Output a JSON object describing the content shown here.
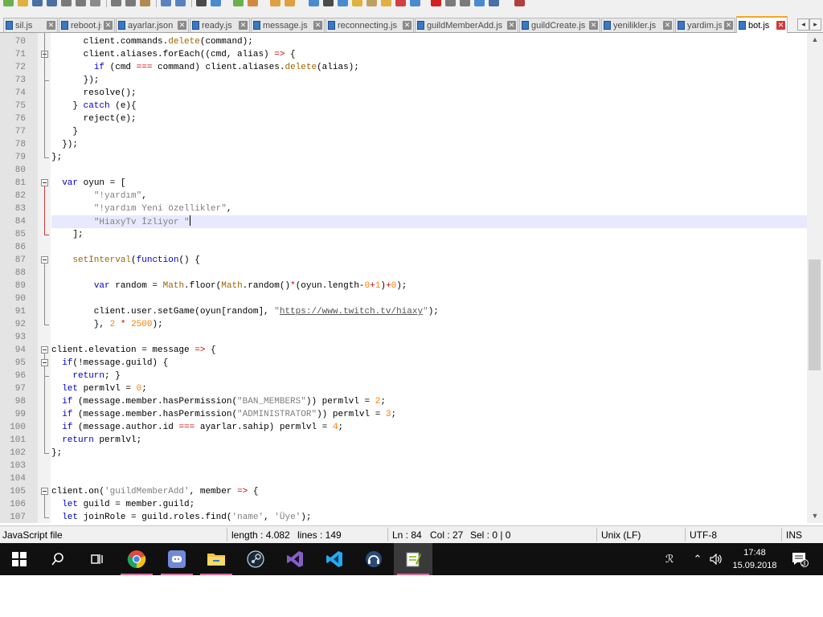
{
  "tabs": [
    {
      "name": "sil.js",
      "active": false
    },
    {
      "name": "reboot.js",
      "active": false
    },
    {
      "name": "ayarlar.json",
      "active": false
    },
    {
      "name": "ready.js",
      "active": false
    },
    {
      "name": "message.js",
      "active": false
    },
    {
      "name": "reconnecting.js",
      "active": false
    },
    {
      "name": "guildMemberAdd.js",
      "active": false
    },
    {
      "name": "guildCreate.js",
      "active": false
    },
    {
      "name": "yenilikler.js",
      "active": false
    },
    {
      "name": "yardim.js",
      "active": false
    },
    {
      "name": "bot.js",
      "active": true
    }
  ],
  "tab_scroll": {
    "left": "◂",
    "right": "▸"
  },
  "colors": {
    "keyword": "#0000c8",
    "string": "#808080",
    "number": "#ff8000",
    "func": "#a06400",
    "operator": "#d00000",
    "url": "#555555",
    "accent_tab": "#f5a623",
    "fold_red": "#d23b3b"
  },
  "editor": {
    "first_line": 70,
    "current_line": 84,
    "lines": [
      [
        [
          "",
          "      client.commands."
        ],
        [
          "f",
          "delete"
        ],
        [
          "",
          "(command);"
        ]
      ],
      [
        [
          "",
          "      client.aliases.forEach((cmd, alias) "
        ],
        [
          "o",
          "=>"
        ],
        [
          "",
          " {"
        ]
      ],
      [
        [
          "",
          "        "
        ],
        [
          "k",
          "if"
        ],
        [
          "",
          " (cmd "
        ],
        [
          "o",
          "==="
        ],
        [
          "",
          " command) client.aliases."
        ],
        [
          "f",
          "delete"
        ],
        [
          "",
          "(alias);"
        ]
      ],
      [
        [
          "",
          "      });"
        ]
      ],
      [
        [
          "",
          "      resolve();"
        ]
      ],
      [
        [
          "",
          "    } "
        ],
        [
          "k",
          "catch"
        ],
        [
          "",
          " (e){"
        ]
      ],
      [
        [
          "",
          "      reject(e);"
        ]
      ],
      [
        [
          "",
          "    }"
        ]
      ],
      [
        [
          "",
          "  });"
        ]
      ],
      [
        [
          "",
          "};"
        ]
      ],
      [
        [
          "",
          ""
        ]
      ],
      [
        [
          "",
          "  "
        ],
        [
          "k",
          "var"
        ],
        [
          "",
          " oyun = ["
        ]
      ],
      [
        [
          "",
          "        "
        ],
        [
          "s",
          "\"!yardım\""
        ],
        [
          "",
          ","
        ]
      ],
      [
        [
          "",
          "        "
        ],
        [
          "s",
          "\"!yardım Yeni özellikler\""
        ],
        [
          "",
          ","
        ]
      ],
      [
        [
          "",
          "        "
        ],
        [
          "s",
          "\"HiaxyTv İzliyor \""
        ]
      ],
      [
        [
          "",
          "    ];"
        ]
      ],
      [
        [
          "",
          ""
        ]
      ],
      [
        [
          "",
          "    "
        ],
        [
          "f",
          "setInterval"
        ],
        [
          "",
          "("
        ],
        [
          "k",
          "function"
        ],
        [
          "",
          "() {"
        ]
      ],
      [
        [
          "",
          ""
        ]
      ],
      [
        [
          "",
          "        "
        ],
        [
          "k",
          "var"
        ],
        [
          "",
          " random = "
        ],
        [
          "f",
          "Math"
        ],
        [
          "",
          ".floor("
        ],
        [
          "f",
          "Math"
        ],
        [
          "",
          ".random()"
        ],
        [
          "o",
          "*"
        ],
        [
          "",
          "(oyun.length-"
        ],
        [
          "n",
          "0"
        ],
        [
          "o",
          "+"
        ],
        [
          "n",
          "1"
        ],
        [
          "",
          ")"
        ],
        [
          "o",
          "+"
        ],
        [
          "n",
          "0"
        ],
        [
          "",
          ");"
        ]
      ],
      [
        [
          "",
          ""
        ]
      ],
      [
        [
          "",
          "        client.user.setGame(oyun[random], "
        ],
        [
          "s",
          "\""
        ],
        [
          "u",
          "https://www.twitch.tv/hiaxy"
        ],
        [
          "s",
          "\""
        ],
        [
          "",
          ");"
        ]
      ],
      [
        [
          "",
          "        }, "
        ],
        [
          "n",
          "2"
        ],
        [
          "",
          " "
        ],
        [
          "o",
          "*"
        ],
        [
          "",
          " "
        ],
        [
          "n",
          "2500"
        ],
        [
          "",
          ");"
        ]
      ],
      [
        [
          "",
          ""
        ]
      ],
      [
        [
          "",
          "client.elevation = message "
        ],
        [
          "o",
          "=>"
        ],
        [
          "",
          " {"
        ]
      ],
      [
        [
          "",
          "  "
        ],
        [
          "k",
          "if"
        ],
        [
          "",
          "(!message.guild) {"
        ]
      ],
      [
        [
          "",
          "    "
        ],
        [
          "k",
          "return"
        ],
        [
          "",
          "; }"
        ]
      ],
      [
        [
          "",
          "  "
        ],
        [
          "k",
          "let"
        ],
        [
          "",
          " permlvl = "
        ],
        [
          "n",
          "0"
        ],
        [
          "",
          ";"
        ]
      ],
      [
        [
          "",
          "  "
        ],
        [
          "k",
          "if"
        ],
        [
          "",
          " (message.member.hasPermission("
        ],
        [
          "s",
          "\"BAN_MEMBERS\""
        ],
        [
          "",
          "))"
        ],
        [
          "",
          " permlvl = "
        ],
        [
          "n",
          "2"
        ],
        [
          "",
          ";"
        ]
      ],
      [
        [
          "",
          "  "
        ],
        [
          "k",
          "if"
        ],
        [
          "",
          " (message.member.hasPermission("
        ],
        [
          "s",
          "\"ADMINISTRATOR\""
        ],
        [
          "",
          ")) permlvl = "
        ],
        [
          "n",
          "3"
        ],
        [
          "",
          ";"
        ]
      ],
      [
        [
          "",
          "  "
        ],
        [
          "k",
          "if"
        ],
        [
          "",
          " (message.author.id "
        ],
        [
          "o",
          "==="
        ],
        [
          "",
          " ayarlar.sahip) permlvl = "
        ],
        [
          "n",
          "4"
        ],
        [
          "",
          ";"
        ]
      ],
      [
        [
          "",
          "  "
        ],
        [
          "k",
          "return"
        ],
        [
          "",
          " permlvl;"
        ]
      ],
      [
        [
          "",
          "};"
        ]
      ],
      [
        [
          "",
          ""
        ]
      ],
      [
        [
          "",
          ""
        ]
      ],
      [
        [
          "",
          "client.on("
        ],
        [
          "s",
          "'guildMemberAdd'"
        ],
        [
          "",
          ", member "
        ],
        [
          "o",
          "=>"
        ],
        [
          "",
          " {"
        ]
      ],
      [
        [
          "",
          "  "
        ],
        [
          "k",
          "let"
        ],
        [
          "",
          " guild = member.guild;"
        ]
      ],
      [
        [
          "",
          "  "
        ],
        [
          "k",
          "let"
        ],
        [
          "",
          " joinRole = guild.roles.find("
        ],
        [
          "s",
          "'name'"
        ],
        [
          "",
          ", "
        ],
        [
          "s",
          "'Üye'"
        ],
        [
          "",
          ");"
        ]
      ]
    ]
  },
  "scrollbar": {
    "up": "▲",
    "down": "▼",
    "thumb_fraction_top": 0.46,
    "thumb_fraction_height": 0.24
  },
  "statusbar": {
    "filetype": "JavaScript file",
    "length": "length : 4.082",
    "lines": "lines : 149",
    "ln": "Ln : 84",
    "col": "Col : 27",
    "sel": "Sel : 0 | 0",
    "eol": "Unix (LF)",
    "encoding": "UTF-8",
    "mode": "INS"
  },
  "taskbar": {
    "time": "17:48",
    "date": "15.09.2018",
    "notification_count": "3",
    "people_glyph": "ℛ",
    "tray_up": "⌃",
    "speaker_glyph": "🔈"
  }
}
